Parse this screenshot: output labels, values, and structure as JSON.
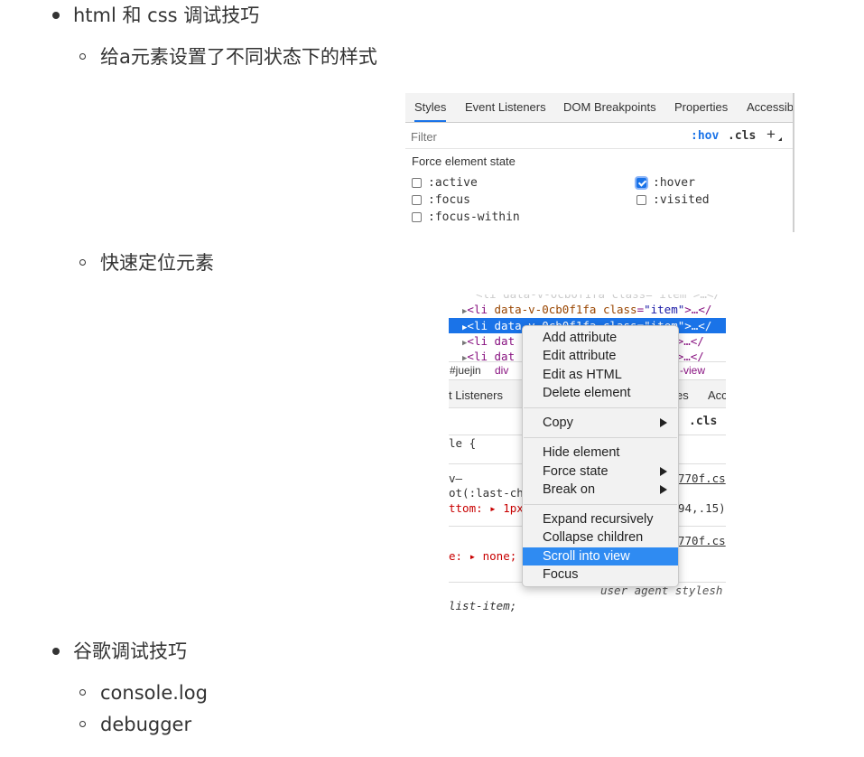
{
  "list": {
    "item1": {
      "label": "html 和 css 调试技巧",
      "sub1": "给a元素设置了不同状态下的样式",
      "sub2": "快速定位元素"
    },
    "item2": {
      "label": "谷歌调试技巧",
      "sub1": "console.log",
      "sub2": "debugger"
    }
  },
  "styles_panel": {
    "tabs": [
      "Styles",
      "Event Listeners",
      "DOM Breakpoints",
      "Properties",
      "Accessib"
    ],
    "filter_placeholder": "Filter",
    "hov": ":hov",
    "cls": ".cls",
    "plus": "+",
    "force_label": "Force element state",
    "states": [
      {
        "label": ":active",
        "checked": false
      },
      {
        "label": ":focus",
        "checked": false
      },
      {
        "label": ":focus-within",
        "checked": false
      },
      {
        "label": ":hover",
        "checked": true
      },
      {
        "label": ":visited",
        "checked": false
      }
    ]
  },
  "elements_panel": {
    "crumb_1": "#juejin",
    "crumb_2": "div",
    "crumb_3": "-view",
    "tab_listeners": "t Listeners",
    "tab_es": "es",
    "tab_acc": "Acc",
    "cls": ".cls",
    "rule_1": "le {",
    "frag_v": "v–",
    "frag_last": "ot(:last-ch",
    "frag_ttom": "ttom: ▸ 1px",
    "frag_770_1": "770f.cs",
    "frag_num": "94,.15)",
    "frag_770_2": "770f.cs",
    "frag_none": "e: ▸ none;",
    "frag_ua": "user agent stylesh",
    "frag_list": "list-item;"
  },
  "context_menu": {
    "items": [
      "Add attribute",
      "Edit attribute",
      "Edit as HTML",
      "Delete element",
      "Copy",
      "Hide element",
      "Force state",
      "Break on",
      "Expand recursively",
      "Collapse children",
      "Scroll into view",
      "Focus"
    ],
    "highlighted": "Scroll into view"
  }
}
